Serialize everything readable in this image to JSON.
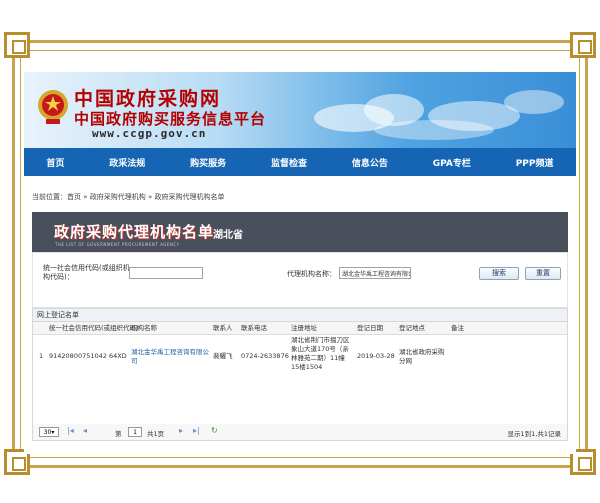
{
  "banner": {
    "title_main": "中国政府采购网",
    "title_sub": "中国政府购买服务信息平台",
    "url": "www.ccgp.gov.cn"
  },
  "nav": [
    "首页",
    "政采法规",
    "购买服务",
    "监督检查",
    "信息公告",
    "GPA专栏",
    "PPP频道"
  ],
  "breadcrumb": "当前位置：首页 » 政府采购代理机构 » 政府采购代理机构名单",
  "section": {
    "title": "政府采购代理机构名单",
    "region": "湖北省",
    "small_text": "THE LIST OF GOVERNMENT PROCUREMENT AGENCY"
  },
  "search": {
    "code_label": "统一社会信用代码(或组织机构代码)：",
    "code_value": "",
    "name_label": "代理机构名称：",
    "name_value": "湖北金华禹工程咨询有限公",
    "search_button": "搜索",
    "reset_button": "重置"
  },
  "grid": {
    "title": "网上登记名单",
    "columns": [
      "统一社会信用代码(或组织代码)",
      "机构名称",
      "联系人",
      "联系电话",
      "注册地址",
      "登记日期",
      "登记地点",
      "备注"
    ],
    "rows": [
      {
        "index": "1",
        "code": "91420800751042 64XD",
        "name": "湖北金华禹工程咨询有限公司",
        "contact": "裴耀飞",
        "phone": "0724-2633876",
        "address": "湖北省荆门市掇刀区象山大道170号（亲林雅苑二期）11幢15楼1504",
        "date": "2019-03-28",
        "place": "湖北省政府采购分网",
        "note": ""
      }
    ]
  },
  "pager": {
    "page_size": "30",
    "page_prefix": "第",
    "page_value": "1",
    "page_suffix": "共1页",
    "info": "显示1到1,共1记录"
  }
}
